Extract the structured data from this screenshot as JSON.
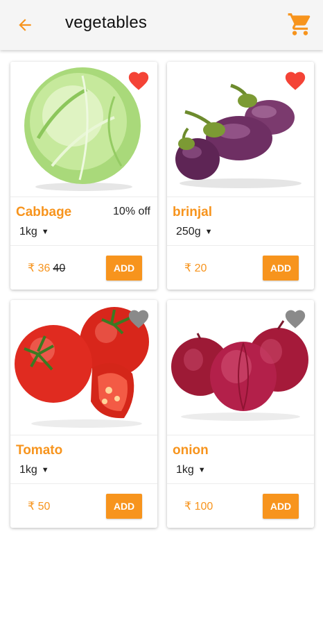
{
  "header": {
    "title": "vegetables",
    "back_icon": "arrow-left-icon",
    "cart_icon": "shopping-cart-icon",
    "accent": "#f7941d"
  },
  "products": [
    {
      "name": "Cabbage",
      "discount": "10% off",
      "qty": "1kg",
      "price": "₹ 36",
      "mrp": "40",
      "add_label": "ADD",
      "favorite": true,
      "image": "cabbage"
    },
    {
      "name": "brinjal",
      "discount": "",
      "qty": "250g",
      "price": "₹ 20",
      "mrp": "",
      "add_label": "ADD",
      "favorite": true,
      "image": "brinjal"
    },
    {
      "name": "Tomato",
      "discount": "",
      "qty": "1kg",
      "price": "₹ 50",
      "mrp": "",
      "add_label": "ADD",
      "favorite": false,
      "image": "tomato"
    },
    {
      "name": "onion",
      "discount": "",
      "qty": "1kg",
      "price": "₹ 100",
      "mrp": "",
      "add_label": "ADD",
      "favorite": false,
      "image": "onion"
    }
  ],
  "colors": {
    "favorite_on": "#f44336",
    "favorite_off": "#8a8a8a",
    "accent": "#f7941d"
  }
}
